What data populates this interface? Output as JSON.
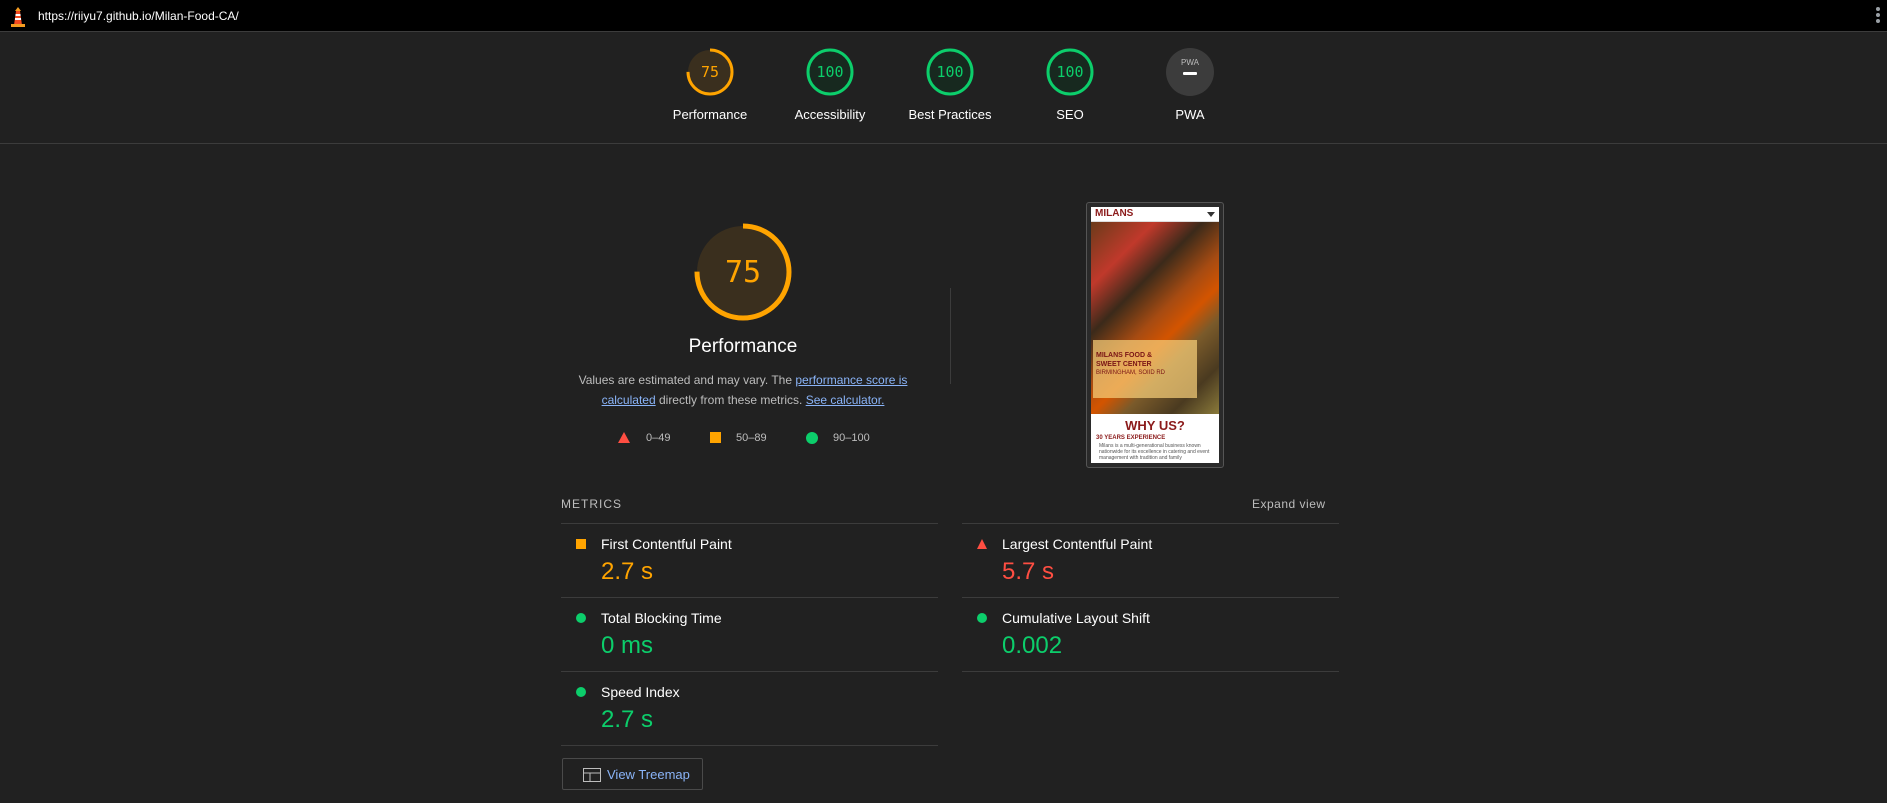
{
  "topbar": {
    "url": "https://riiyu7.github.io/Milan-Food-CA/"
  },
  "categories": [
    {
      "label": "Performance",
      "score": "75",
      "value": 0.75,
      "color": "#ffa400"
    },
    {
      "label": "Accessibility",
      "score": "100",
      "value": 1.0,
      "color": "#0cce6b"
    },
    {
      "label": "Best Practices",
      "score": "100",
      "value": 1.0,
      "color": "#0cce6b"
    },
    {
      "label": "SEO",
      "score": "100",
      "value": 1.0,
      "color": "#0cce6b"
    },
    {
      "label": "PWA",
      "score": "",
      "badge": "PWA",
      "color": "#9aa0a6"
    }
  ],
  "performance": {
    "score": "75",
    "value": 0.75,
    "title": "Performance",
    "desc_prefix": "Values are estimated and may vary. The ",
    "desc_link1": "performance score is calculated",
    "desc_middle": " directly from these metrics. ",
    "desc_link2": "See calculator."
  },
  "legend": {
    "fail": "0–49",
    "average": "50–89",
    "pass": "90–100"
  },
  "screenshot": {
    "brand": "MILANS",
    "card_line1": "MILANS FOOD &",
    "card_line2": "SWEET CENTER",
    "card_line3": "BIRMINGHAM, SOIID RD",
    "heading": "WHY US?",
    "subheading": "30 YEARS EXPERIENCE",
    "body": "Milans is a multi-generational business known nationwide for its excellence in catering and event management with tradition and family"
  },
  "metrics": {
    "header": "METRICS",
    "expand": "Expand view",
    "fcp": {
      "label": "First Contentful Paint",
      "value": "2.7 s"
    },
    "lcp": {
      "label": "Largest Contentful Paint",
      "value": "5.7 s"
    },
    "tbt": {
      "label": "Total Blocking Time",
      "value": "0 ms"
    },
    "cls": {
      "label": "Cumulative Layout Shift",
      "value": "0.002"
    },
    "si": {
      "label": "Speed Index",
      "value": "2.7 s"
    }
  },
  "treemap": {
    "label": "View Treemap"
  },
  "colors": {
    "average": "#ffa400",
    "fail": "#ff4e42",
    "pass": "#0cce6b",
    "link": "#8ab4f8"
  }
}
